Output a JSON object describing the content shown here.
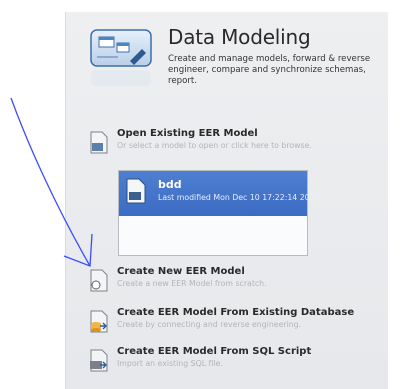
{
  "header": {
    "title": "Data Modeling",
    "description": "Create and manage models, forward & reverse engineer, compare and synchronize schemas, report."
  },
  "actions": [
    {
      "title": "Open Existing EER Model",
      "subtitle": "Or select a model to open or click here to browse."
    },
    {
      "title": "Create New EER Model",
      "subtitle": "Create a new EER Model from scratch."
    },
    {
      "title": "Create EER Model From Existing Database",
      "subtitle": "Create by connecting and reverse engineering."
    },
    {
      "title": "Create EER Model From SQL Script",
      "subtitle": "Import an existing SQL file."
    }
  ],
  "recent_models": [
    {
      "name": "bdd",
      "modified": "Last modified Mon Dec 10 17:22:14 2012"
    }
  ],
  "colors": {
    "annotation_stroke": "#3a4cff",
    "selected_item": "#3f6fc6"
  }
}
